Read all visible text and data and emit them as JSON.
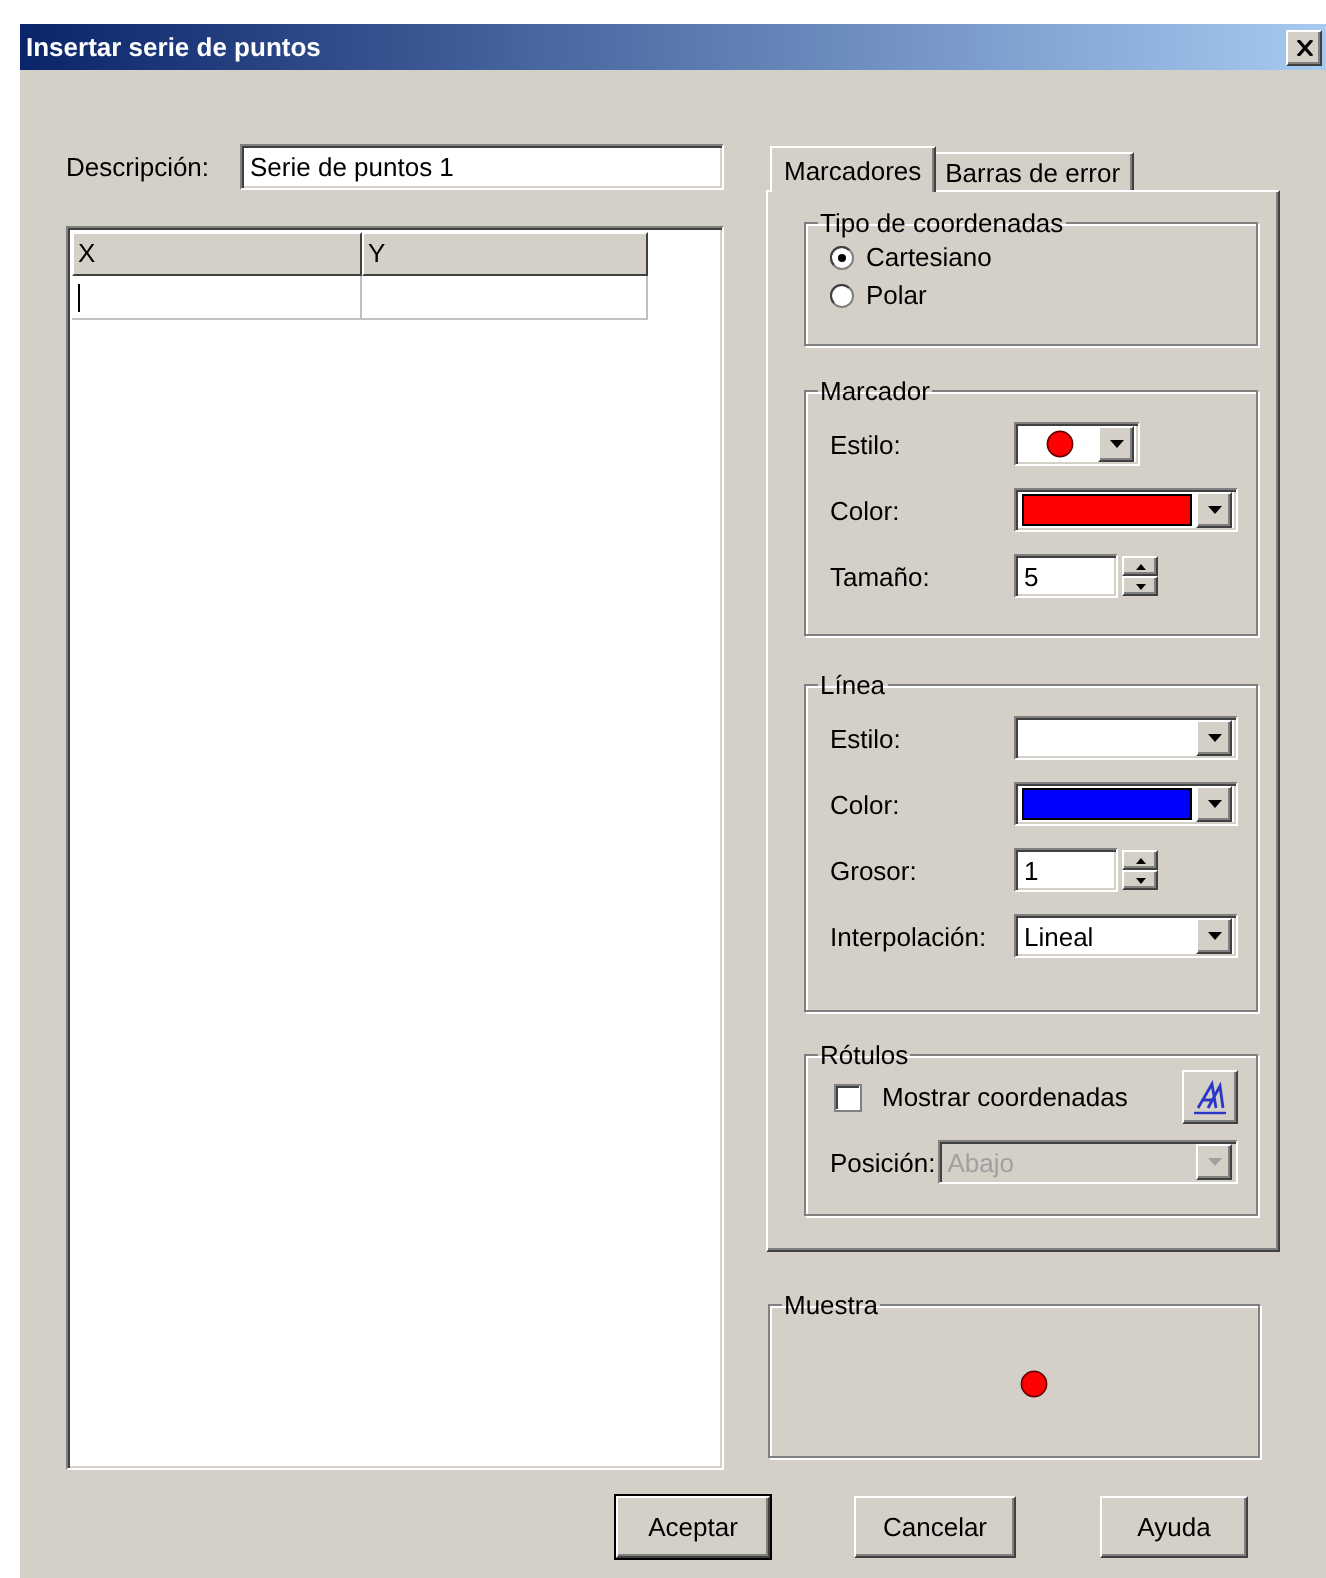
{
  "window": {
    "title": "Insertar serie de puntos"
  },
  "description": {
    "label": "Descripción:",
    "value": "Serie de puntos 1"
  },
  "table": {
    "columns": [
      "X",
      "Y"
    ]
  },
  "tabs": [
    {
      "label": "Marcadores",
      "selected": true
    },
    {
      "label": "Barras de error",
      "selected": false
    }
  ],
  "coordinate_type": {
    "title": "Tipo de coordenadas",
    "options": [
      {
        "label": "Cartesiano",
        "selected": true
      },
      {
        "label": "Polar",
        "selected": false
      }
    ]
  },
  "marker": {
    "title": "Marcador",
    "fields": [
      {
        "kind": "marker-style",
        "label": "Estilo:"
      },
      {
        "kind": "color",
        "label": "Color:",
        "color": "#ff0000"
      },
      {
        "kind": "spin",
        "label": "Tamaño:",
        "value": "5"
      }
    ]
  },
  "line": {
    "title": "Línea",
    "fields": [
      {
        "kind": "combo",
        "label": "Estilo:"
      },
      {
        "kind": "color",
        "label": "Color:",
        "color": "#0000ff"
      },
      {
        "kind": "spin",
        "label": "Grosor:",
        "value": "1"
      },
      {
        "kind": "combo",
        "label": "Interpolación:",
        "value": "Lineal"
      }
    ]
  },
  "labels": {
    "title": "Rótulos",
    "show_coordinates": {
      "label": "Mostrar coordenadas",
      "checked": false
    },
    "position": {
      "label": "Posición:",
      "value": "Abajo",
      "disabled": true
    }
  },
  "sample": {
    "title": "Muestra"
  },
  "buttons": [
    {
      "label": "Aceptar",
      "default": true
    },
    {
      "label": "Cancelar",
      "default": false
    },
    {
      "label": "Ayuda",
      "default": false
    }
  ]
}
